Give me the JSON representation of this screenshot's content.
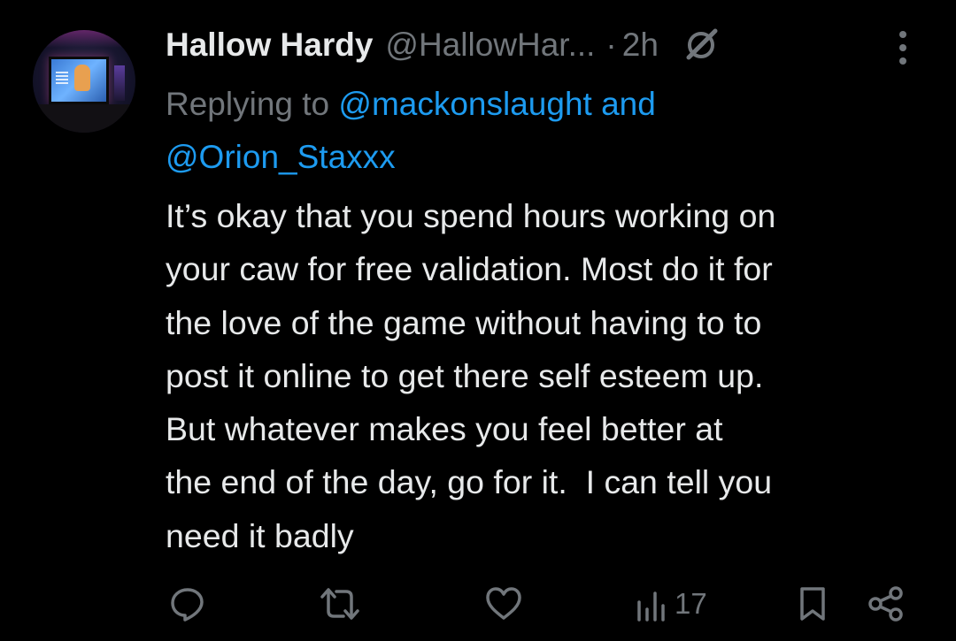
{
  "tweet": {
    "author_name": "Hallow Hardy",
    "author_handle": "@HallowHar...",
    "separator": "·",
    "time": "2h",
    "replying_prefix": "Replying to ",
    "mention_1": "@mackonslaught",
    "replying_and": " and",
    "mention_2": "@Orion_Staxxx",
    "body_lines": [
      "It’s okay that you spend hours working on",
      "your caw for free validation. Most do it for",
      "the love of the game without having to to",
      "post it online to get there self esteem up.",
      "But whatever makes you feel better at",
      "the end of the day, go for it.  I can tell you",
      "need it badly"
    ]
  },
  "actions": {
    "reply_icon": "reply-icon",
    "retweet_icon": "retweet-icon",
    "like_icon": "like-icon",
    "views_icon": "views-icon",
    "views_count": "17",
    "bookmark_icon": "bookmark-icon",
    "share_icon": "share-icon"
  },
  "colors": {
    "background": "#000000",
    "text_primary": "#e7e9ea",
    "text_secondary": "#71767b",
    "link": "#1d9bf0"
  }
}
